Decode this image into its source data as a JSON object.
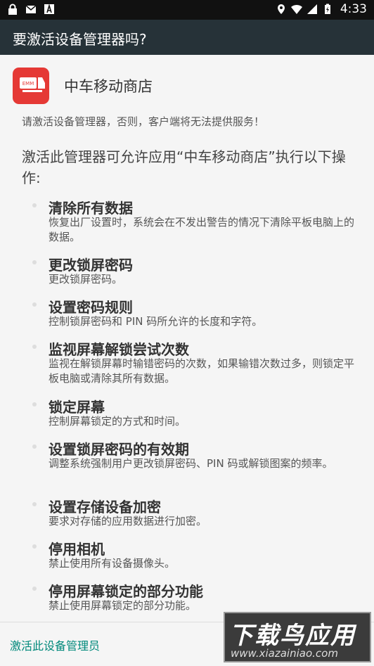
{
  "status_bar": {
    "time": "4:33",
    "left_icons": [
      "lock-icon",
      "mail-icon",
      "font-download-icon"
    ],
    "right_icons": [
      "location-icon",
      "wifi-icon",
      "signal-icon",
      "battery-icon"
    ]
  },
  "app_bar": {
    "title": "要激活设备管理器吗?"
  },
  "app": {
    "name": "中车移动商店",
    "icon_label": "EMM",
    "icon_color": "#e53935"
  },
  "warning_text": "请激活设备管理器，否则，客户端将无法提供服务！",
  "intro_text": "激活此管理器可允许应用“中车移动商店”执行以下操作:",
  "permissions": [
    {
      "title": "清除所有数据",
      "desc": "恢复出厂设置时，系统会在不发出警告的情况下清除平板电脑上的数据。"
    },
    {
      "title": "更改锁屏密码",
      "desc": "更改锁屏密码。"
    },
    {
      "title": "设置密码规则",
      "desc": "控制锁屏密码和 PIN 码所允许的长度和字符。"
    },
    {
      "title": "监视屏幕解锁尝试次数",
      "desc": "监视在解锁屏幕时输错密码的次数，如果输错次数过多，则锁定平板电脑或清除其所有数据。"
    },
    {
      "title": "锁定屏幕",
      "desc": "控制屏幕锁定的方式和时间。"
    },
    {
      "title": "设置锁屏密码的有效期",
      "desc": "调整系统强制用户更改锁屏密码、PIN 码或解锁图案的频率。"
    },
    {
      "title": "设置存储设备加密",
      "desc": "要求对存储的应用数据进行加密。"
    },
    {
      "title": "停用相机",
      "desc": "禁止使用所有设备摄像头。"
    },
    {
      "title": "停用屏幕锁定的部分功能",
      "desc": "禁止使用屏幕锁定的部分功能。"
    }
  ],
  "bottom": {
    "activate_label": "激活此设备管理员"
  },
  "watermark": {
    "main": "下载鸟应用",
    "sub": "www.xiazainiao.com"
  },
  "colors": {
    "status_bar": "#111111",
    "app_bar": "#263238",
    "accent": "#00897b"
  }
}
